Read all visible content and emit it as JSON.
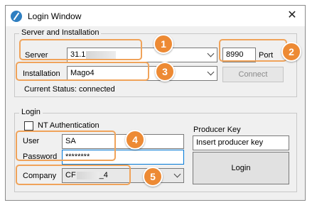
{
  "window": {
    "title": "Login Window",
    "close_glyph": "✕"
  },
  "server_group": {
    "title": "Server and Installation",
    "server_label": "Server",
    "server_value": "31.1",
    "port_value": "8990",
    "port_label": "Port",
    "installation_label": "Installation",
    "installation_value": "Mago4",
    "connect_label": "Connect",
    "status_text": "Current Status: connected"
  },
  "login_group": {
    "title": "Login",
    "nt_auth_label": "NT Authentication",
    "user_label": "User",
    "user_value": "SA",
    "password_label": "Password",
    "password_value": "********",
    "company_label": "Company",
    "company_prefix": "CF",
    "company_suffix": "_4",
    "producer_key_label": "Producer Key",
    "producer_key_placeholder": "Insert producer key",
    "login_label": "Login"
  },
  "badges": [
    "1",
    "2",
    "3",
    "4",
    "5"
  ],
  "colors": {
    "annotation": "#ed8a34",
    "window_bg": "#f0f0f0"
  }
}
